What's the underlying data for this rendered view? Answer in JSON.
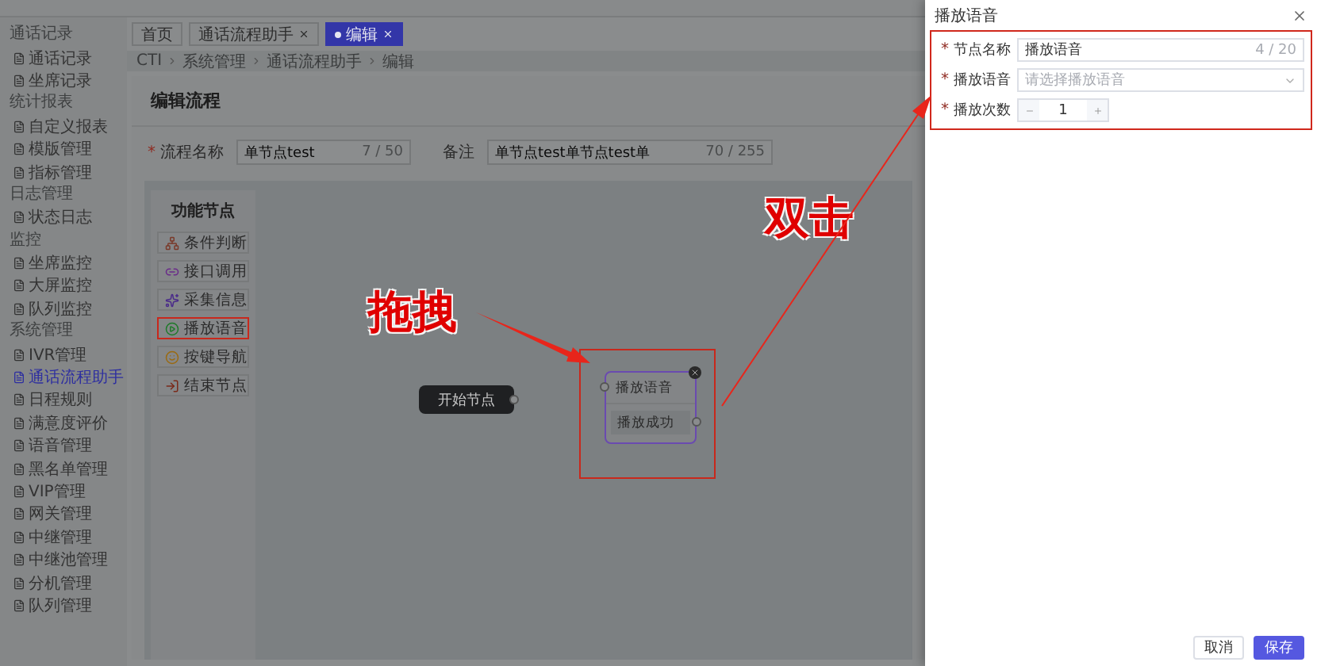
{
  "sidebar": {
    "groups": [
      {
        "title": "通话记录",
        "items": [
          {
            "label": "通话记录",
            "selected": false
          },
          {
            "label": "坐席记录",
            "selected": false
          }
        ]
      },
      {
        "title": "统计报表",
        "items": [
          {
            "label": "自定义报表",
            "selected": false
          },
          {
            "label": "模版管理",
            "selected": false
          },
          {
            "label": "指标管理",
            "selected": false
          }
        ]
      },
      {
        "title": "日志管理",
        "items": [
          {
            "label": "状态日志",
            "selected": false
          }
        ]
      },
      {
        "title": "监控",
        "items": [
          {
            "label": "坐席监控",
            "selected": false
          },
          {
            "label": "大屏监控",
            "selected": false
          },
          {
            "label": "队列监控",
            "selected": false
          }
        ]
      },
      {
        "title": "系统管理",
        "items": [
          {
            "label": "IVR管理",
            "selected": false
          },
          {
            "label": "通话流程助手",
            "selected": true
          },
          {
            "label": "日程规则",
            "selected": false
          },
          {
            "label": "满意度评价",
            "selected": false
          },
          {
            "label": "语音管理",
            "selected": false
          },
          {
            "label": "黑名单管理",
            "selected": false
          },
          {
            "label": "VIP管理",
            "selected": false
          },
          {
            "label": "网关管理",
            "selected": false
          },
          {
            "label": "中继管理",
            "selected": false
          },
          {
            "label": "中继池管理",
            "selected": false
          },
          {
            "label": "分机管理",
            "selected": false
          },
          {
            "label": "队列管理",
            "selected": false
          }
        ]
      }
    ]
  },
  "tabs": [
    {
      "label": "首页",
      "closable": false,
      "selected": false
    },
    {
      "label": "通话流程助手",
      "closable": true,
      "selected": false
    },
    {
      "label": "编辑",
      "closable": true,
      "selected": true
    }
  ],
  "breadcrumb": [
    "CTI",
    "系统管理",
    "通话流程助手",
    "编辑"
  ],
  "page_title": "编辑流程",
  "form": [
    {
      "label": "流程名称",
      "required_mark": "*",
      "value": "单节点test",
      "count": "7 / 50"
    },
    {
      "label": "备注",
      "value": "单节点test单节点test单",
      "count": "70 / 255"
    }
  ],
  "palette": {
    "title": "功能节点",
    "items": [
      {
        "kind": "condition",
        "label": "条件判断",
        "marked": false
      },
      {
        "kind": "api",
        "label": "接口调用",
        "marked": false
      },
      {
        "kind": "collect",
        "label": "采集信息",
        "marked": false
      },
      {
        "kind": "play",
        "label": "播放语音",
        "marked": true
      },
      {
        "kind": "keypad",
        "label": "按键导航",
        "marked": false
      },
      {
        "kind": "end",
        "label": "结束节点",
        "marked": false
      }
    ]
  },
  "canvas": {
    "nodes": [
      {
        "kind": "start",
        "label": "开始节点"
      },
      {
        "kind": "play",
        "label": "播放语音",
        "outcome": "播放成功",
        "selected": true,
        "marked": true
      }
    ]
  },
  "annotations": {
    "drag": "拖拽",
    "double_click": "双击"
  },
  "drawer": {
    "title": "播放语音",
    "marked": true,
    "fields": [
      {
        "kind": "text",
        "label": "节点名称",
        "required_mark": "*",
        "value": "播放语音",
        "count": "4 / 20"
      },
      {
        "kind": "select",
        "label": "播放语音",
        "required_mark": "*",
        "placeholder": "请选择播放语音"
      },
      {
        "kind": "number",
        "label": "播放次数",
        "required_mark": "*",
        "value": "1"
      }
    ],
    "buttons": [
      {
        "label": "取消",
        "primary": false
      },
      {
        "label": "保存",
        "primary": true
      }
    ]
  }
}
